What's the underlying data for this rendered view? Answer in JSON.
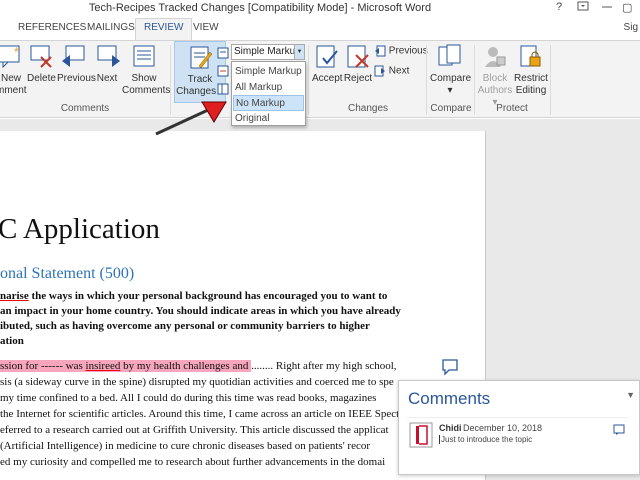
{
  "window": {
    "title": "Tech-Recipes Tracked Changes [Compatibility Mode] - Microsoft Word",
    "help": "?",
    "restore": "▢"
  },
  "tabs": [
    "REFERENCES",
    "MAILINGS",
    "REVIEW",
    "VIEW"
  ],
  "signin": "Sig",
  "ribbon": {
    "comments": {
      "new_l1": "New",
      "new_l2": "mment",
      "delete": "Delete",
      "previous": "Previous",
      "next": "Next",
      "show_l1": "Show",
      "show_l2": "Comments",
      "label": "Comments"
    },
    "tracking": {
      "track_l1": "Track",
      "track_l2": "Changes",
      "markup_selected": "Simple Markup"
    },
    "changes": {
      "accept": "Accept",
      "reject": "Reject",
      "previous": "Previous",
      "next": "Next",
      "label": "Changes"
    },
    "compare": {
      "compare": "Compare",
      "label": "Compare"
    },
    "protect": {
      "block_l1": "Block",
      "block_l2": "Authors",
      "restrict_l1": "Restrict",
      "restrict_l2": "Editing",
      "label": "Protect"
    }
  },
  "markup_options": [
    "Simple Markup",
    "All Markup",
    "No Markup",
    "Original"
  ],
  "markup_highlighted": "No Markup",
  "document": {
    "title": "C Application",
    "heading": "onal Statement (500)",
    "bold_lines": [
      [
        "narise",
        " the ways in which your personal background has encouraged you to want to"
      ],
      [
        "",
        " an impact in your home country. You should indicate areas in which you have already"
      ],
      [
        "",
        "ibuted, such as having overcome any personal or community barriers to higher"
      ],
      [
        "",
        "ation"
      ]
    ],
    "hl_text_1": "ssion for ------ was ",
    "hl_text_2": "insireed",
    "hl_text_3": " by my health challenges and ",
    "after_hl": "........ Right after my high school,",
    "lines": [
      "sis (a sideway curve in the spine) disrupted my quotidian activities and coerced me to spe",
      "my time confined to a bed. All I could do during this time was read books, magazines",
      "the Internet for scientific articles. Around this time, I came across an article on IEEE Spect",
      "eferred to a research carried out at Griffith University. This article discussed the applicat",
      "(Artificial Intelligence) in medicine to cure chronic diseases based on patients' recor",
      "ed my curiosity and compelled me to research about further advancements in the domai"
    ]
  },
  "comments_pane": {
    "title": "Comments",
    "author": "Chidi",
    "date": "December 10, 2018",
    "text": "Just to introduce the topic"
  },
  "colors": {
    "accent": "#2b579a",
    "highlight": "#f7a6bd",
    "arrow": "#e02020"
  }
}
